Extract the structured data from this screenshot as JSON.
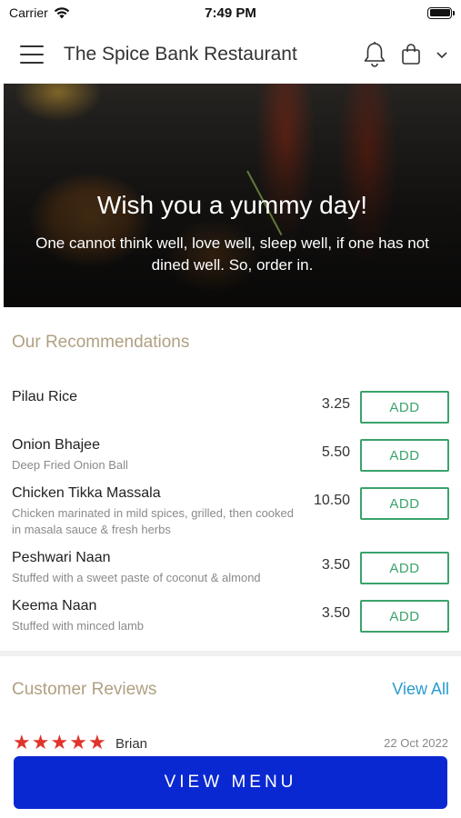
{
  "status_bar": {
    "carrier": "Carrier",
    "time": "7:49 PM"
  },
  "header": {
    "title": "The Spice Bank Restaurant"
  },
  "hero": {
    "title": "Wish you a yummy day!",
    "subtitle": "One cannot think well, love well, sleep well, if one has not dined well. So, order in."
  },
  "recommendations": {
    "title": "Our Recommendations",
    "items": [
      {
        "name": "Pilau Rice",
        "description": "",
        "price": "3.25",
        "button": "ADD"
      },
      {
        "name": "Onion Bhajee",
        "description": "Deep Fried Onion Ball",
        "price": "5.50",
        "button": "ADD"
      },
      {
        "name": "Chicken Tikka Massala",
        "description": "Chicken marinated in mild spices, grilled, then cooked in masala sauce & fresh herbs",
        "price": "10.50",
        "button": "ADD"
      },
      {
        "name": "Peshwari Naan",
        "description": "Stuffed with a sweet paste of coconut & almond",
        "price": "3.50",
        "button": "ADD"
      },
      {
        "name": "Keema Naan",
        "description": "Stuffed with minced lamb",
        "price": "3.50",
        "button": "ADD"
      }
    ]
  },
  "reviews": {
    "title": "Customer Reviews",
    "view_all": "View All",
    "items": [
      {
        "rating": 5,
        "author": "Brian",
        "date": "22 Oct 2022"
      }
    ]
  },
  "footer": {
    "view_menu": "VIEW MENU"
  },
  "colors": {
    "accent": "#0a28d2",
    "add_green": "#3aa36b",
    "section_title": "#b0a082",
    "link": "#2a9bd0",
    "star": "#e0342a"
  }
}
